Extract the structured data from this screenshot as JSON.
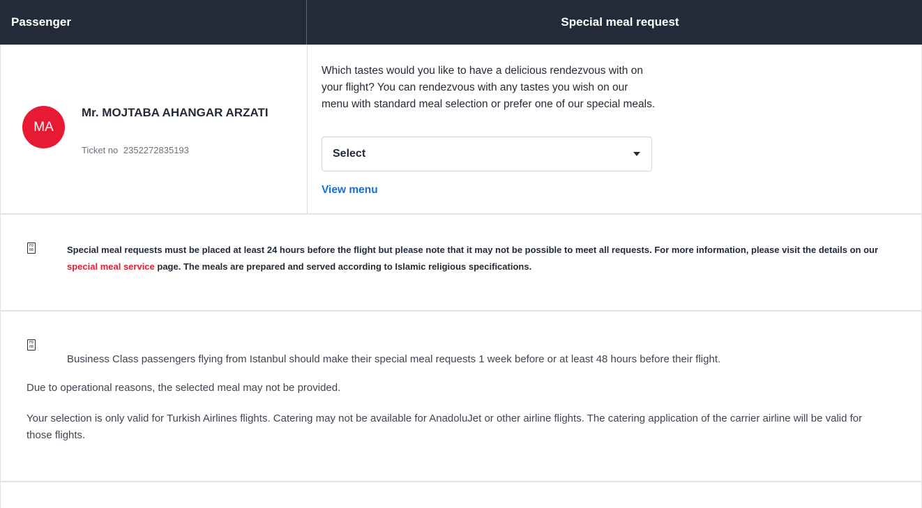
{
  "header": {
    "passenger_label": "Passenger",
    "meal_label": "Special meal request"
  },
  "passenger": {
    "initials": "MA",
    "name": "Mr. MOJTABA AHANGAR ARZATI",
    "ticket_label": "Ticket no",
    "ticket_number": "2352272835193",
    "avatar_color": "#e81932"
  },
  "meal": {
    "description": "Which tastes would you like to have a delicious rendezvous with on your flight? You can rendezvous with any tastes you wish on our menu with standard meal selection or prefer one of our special meals.",
    "select_value": "Select",
    "view_menu_label": "View menu"
  },
  "info1": {
    "icon": "info-icon",
    "text_before": "Special meal requests must be placed at least 24 hours before the flight but please note that it may not be possible to meet all requests. For more information, please visit the details on our ",
    "link_text": "special meal service",
    "text_after": " page. The meals are prepared and served according to Islamic religious specifications."
  },
  "info2": {
    "icon": "info-icon",
    "paragraphs": [
      "Business Class passengers flying from Istanbul should make their special meal requests 1 week before or at least 48 hours before their flight.",
      "Due to operational reasons, the selected meal may not be provided.",
      "Your selection is only valid for Turkish Airlines flights. Catering may not be available for AnadoluJet or other airline flights. The catering application of the carrier airline will be valid for those flights."
    ]
  },
  "colors": {
    "header_bg": "#232b38",
    "brand_red": "#e81932",
    "link_blue": "#1c6ed5"
  }
}
